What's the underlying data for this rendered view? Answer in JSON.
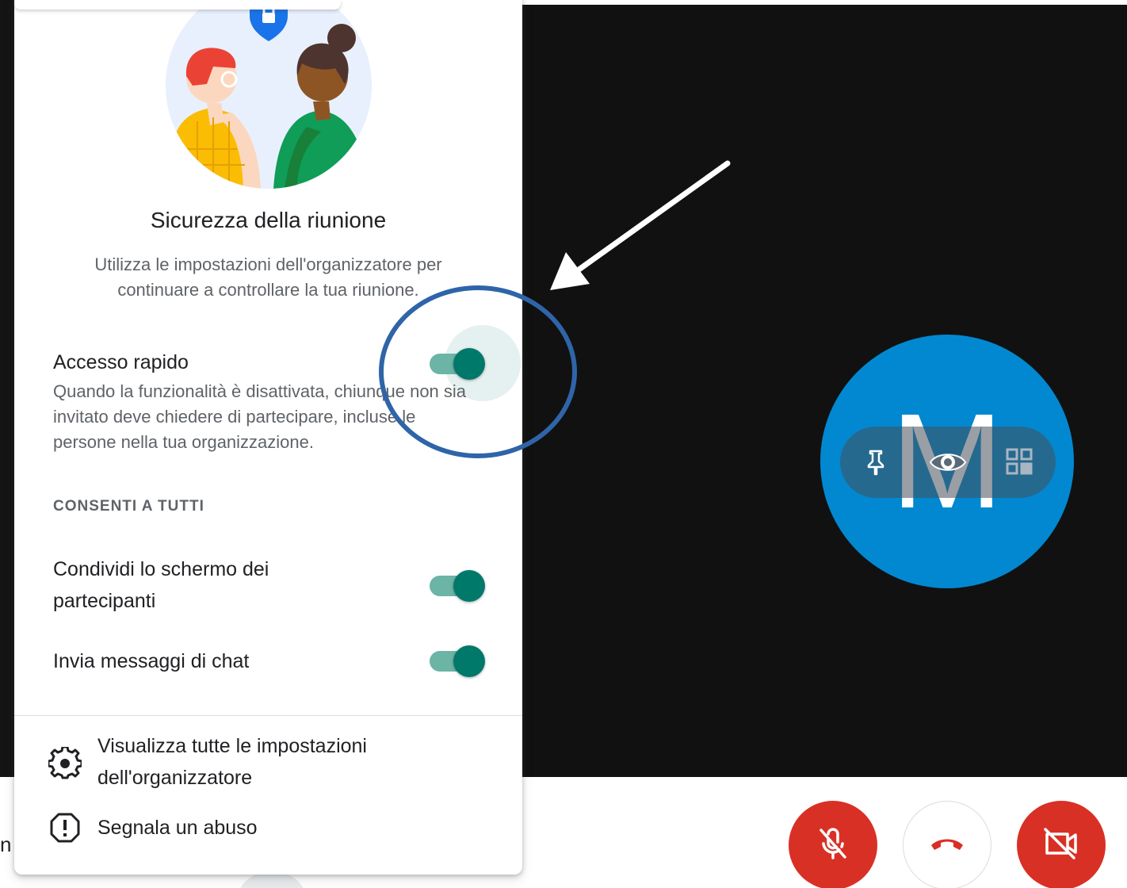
{
  "panel": {
    "title": "Sicurezza della riunione",
    "description": "Utilizza le impostazioni dell'organizzatore per continuare a controllare la tua riunione.",
    "quick_access": {
      "label": "Accesso rapido",
      "description": "Quando la funzionalità è disattivata, chiunque non sia invitato deve chiedere di partecipare, incluse le persone nella tua organizzazione.",
      "enabled": true
    },
    "section_header": "CONSENTI A TUTTI",
    "settings": [
      {
        "label_line1": "Condividi lo schermo dei",
        "label_line2": "partecipanti",
        "enabled": true
      },
      {
        "label_line1": "Invia messaggi di chat",
        "label_line2": "",
        "enabled": true
      }
    ],
    "footer": {
      "host_settings_line1": "Visualizza tutte le impostazioni",
      "host_settings_line2": "dell'organizzatore",
      "report_abuse": "Segnala un abuso"
    }
  },
  "participant": {
    "initial": "M",
    "avatar_color": "#0288d1"
  },
  "tile_controls": {
    "icons": [
      "pin-icon",
      "eye-icon",
      "layout-grid-icon"
    ]
  },
  "controls": {
    "icons": [
      "mic-off-icon",
      "hang-up-icon",
      "camera-off-icon"
    ]
  },
  "bottom_left_text": "n",
  "colors": {
    "toggle_on": "#00796b",
    "toggle_track": "#6bb4a6",
    "danger": "#d93025",
    "annotation_circle": "#2f64a8",
    "annotation_arrow": "#ffffff"
  }
}
